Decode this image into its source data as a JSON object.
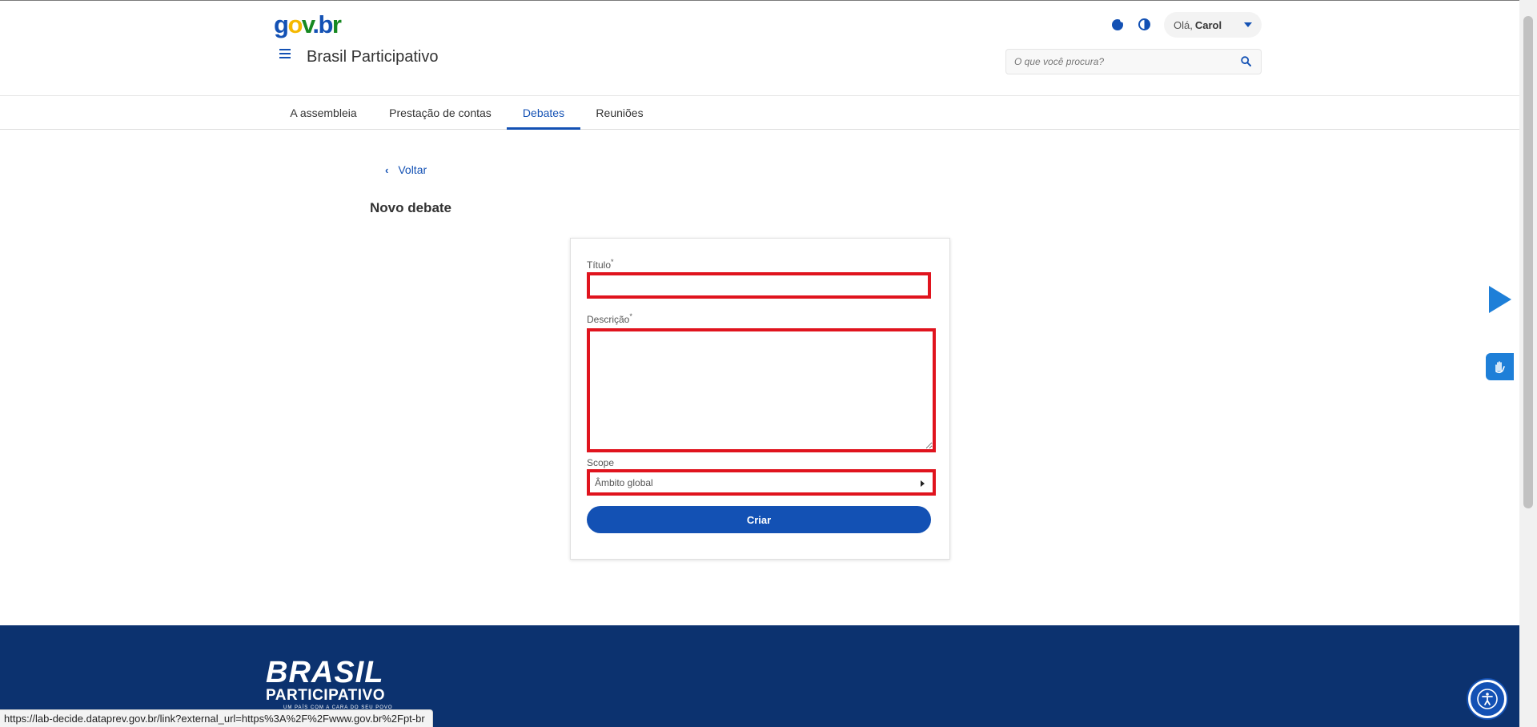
{
  "header": {
    "logo": {
      "g": "g",
      "o": "o",
      "v": "v",
      "dot": ".",
      "b": "b",
      "r": "r"
    },
    "site_title": "Brasil Participativo",
    "user_greeting": "Olá,",
    "user_name": "Carol",
    "search_placeholder": "O que você procura?"
  },
  "nav": {
    "tabs": [
      {
        "label": "A assembleia",
        "active": false
      },
      {
        "label": "Prestação de contas",
        "active": false
      },
      {
        "label": "Debates",
        "active": true
      },
      {
        "label": "Reuniões",
        "active": false
      }
    ]
  },
  "page": {
    "back_label": "Voltar",
    "title": "Novo debate"
  },
  "form": {
    "title_label": "Título",
    "title_value": "",
    "description_label": "Descrição",
    "description_value": "",
    "required_mark": "*",
    "scope_label": "Scope",
    "scope_value": "Âmbito global",
    "submit_label": "Criar"
  },
  "footer": {
    "brand_line1": "BRASIL",
    "brand_line2": "PARTICIPATIVO",
    "brand_tagline": "UM PAÍS COM A CARA DO SEU POVO"
  },
  "status_bar": {
    "url": "https://lab-decide.dataprev.gov.br/link?external_url=https%3A%2F%2Fwww.gov.br%2Fpt-br"
  },
  "colors": {
    "primary": "#1351b4",
    "footer_bg": "#0c326f",
    "highlight_border": "#e0141e",
    "widget_blue": "#1e7fd8"
  },
  "icons": {
    "menu": "hamburger-icon",
    "cookie": "cookie-icon",
    "contrast": "contrast-icon",
    "search": "search-icon",
    "dropdown": "chevron-down-icon",
    "back": "chevron-left-icon",
    "scope_arrow": "caret-right-icon",
    "play": "play-icon",
    "sign_language": "hand-icon",
    "accessibility": "accessibility-icon"
  }
}
